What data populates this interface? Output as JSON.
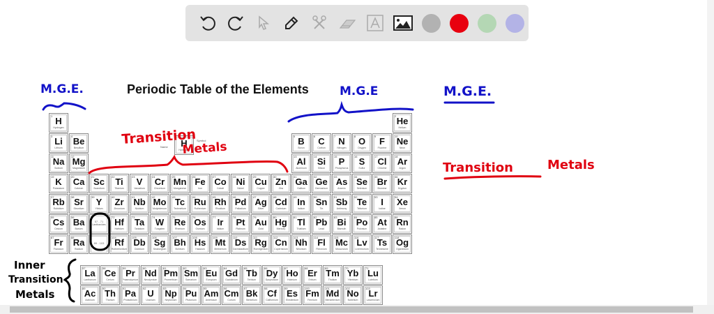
{
  "toolbar": {
    "tools": [
      "undo-icon",
      "redo-icon",
      "select-icon",
      "pen-icon",
      "tools-icon",
      "eraser-icon",
      "text-icon",
      "image-icon"
    ],
    "colors": [
      "#b2b2b2",
      "#e8000f",
      "#b4d7b4",
      "#b3b3e6"
    ]
  },
  "title": "Periodic Table of the Elements",
  "key": {
    "symbol": "H",
    "name_label": "Name",
    "symbol_label": "Symbol",
    "name": "Hydrogen"
  },
  "placeholders": {
    "lanthanides": "57 - 71",
    "lanthanides_name": "Lanthanides",
    "actinides": "89 - 103"
  },
  "elements": [
    [
      1,
      "H",
      "Hydrogen"
    ],
    [
      2,
      "He",
      "Helium"
    ],
    [
      3,
      "Li",
      "Lithium"
    ],
    [
      4,
      "Be",
      "Beryllium"
    ],
    [
      5,
      "B",
      "Boron"
    ],
    [
      6,
      "C",
      "Carbon"
    ],
    [
      7,
      "N",
      "Nitrogen"
    ],
    [
      8,
      "O",
      "Oxygen"
    ],
    [
      9,
      "F",
      "Fluorine"
    ],
    [
      10,
      "Ne",
      "Neon"
    ],
    [
      11,
      "Na",
      "Sodium"
    ],
    [
      12,
      "Mg",
      "Magnesium"
    ],
    [
      13,
      "Al",
      "Aluminum"
    ],
    [
      14,
      "Si",
      "Silicon"
    ],
    [
      15,
      "P",
      "Phosphorus"
    ],
    [
      16,
      "S",
      "Sulfur"
    ],
    [
      17,
      "Cl",
      "Chlorine"
    ],
    [
      18,
      "Ar",
      "Argon"
    ],
    [
      19,
      "K",
      "Potassium"
    ],
    [
      20,
      "Ca",
      "Calcium"
    ],
    [
      21,
      "Sc",
      "Scandium"
    ],
    [
      22,
      "Ti",
      "Titanium"
    ],
    [
      23,
      "V",
      "Vanadium"
    ],
    [
      24,
      "Cr",
      "Chromium"
    ],
    [
      25,
      "Mn",
      "Manganese"
    ],
    [
      26,
      "Fe",
      "Iron"
    ],
    [
      27,
      "Co",
      "Cobalt"
    ],
    [
      28,
      "Ni",
      "Nickel"
    ],
    [
      29,
      "Cu",
      "Copper"
    ],
    [
      30,
      "Zn",
      "Zinc"
    ],
    [
      31,
      "Ga",
      "Gallium"
    ],
    [
      32,
      "Ge",
      "Germanium"
    ],
    [
      33,
      "As",
      "Arsenic"
    ],
    [
      34,
      "Se",
      "Selenium"
    ],
    [
      35,
      "Br",
      "Bromine"
    ],
    [
      36,
      "Kr",
      "Krypton"
    ],
    [
      37,
      "Rb",
      "Rubidium"
    ],
    [
      38,
      "Sr",
      "Strontium"
    ],
    [
      39,
      "Y",
      "Yttrium"
    ],
    [
      40,
      "Zr",
      "Zirconium"
    ],
    [
      41,
      "Nb",
      "Niobium"
    ],
    [
      42,
      "Mo",
      "Molybdenum"
    ],
    [
      43,
      "Tc",
      "Technetium"
    ],
    [
      44,
      "Ru",
      "Ruthenium"
    ],
    [
      45,
      "Rh",
      "Rhodium"
    ],
    [
      46,
      "Pd",
      "Palladium"
    ],
    [
      47,
      "Ag",
      "Silver"
    ],
    [
      48,
      "Cd",
      "Cadmium"
    ],
    [
      49,
      "In",
      "Indium"
    ],
    [
      50,
      "Sn",
      "Tin"
    ],
    [
      51,
      "Sb",
      "Antimony"
    ],
    [
      52,
      "Te",
      "Tellurium"
    ],
    [
      53,
      "I",
      "Iodine"
    ],
    [
      54,
      "Xe",
      "Xenon"
    ],
    [
      55,
      "Cs",
      "Cesium"
    ],
    [
      56,
      "Ba",
      "Barium"
    ],
    [
      57,
      "La",
      "Lanthanum"
    ],
    [
      58,
      "Ce",
      "Cerium"
    ],
    [
      59,
      "Pr",
      "Praseodymium"
    ],
    [
      60,
      "Nd",
      "Neodymium"
    ],
    [
      61,
      "Pm",
      "Promethium"
    ],
    [
      62,
      "Sm",
      "Samarium"
    ],
    [
      63,
      "Eu",
      "Europium"
    ],
    [
      64,
      "Gd",
      "Gadolinium"
    ],
    [
      65,
      "Tb",
      "Terbium"
    ],
    [
      66,
      "Dy",
      "Dysprosium"
    ],
    [
      67,
      "Ho",
      "Holmium"
    ],
    [
      68,
      "Er",
      "Erbium"
    ],
    [
      69,
      "Tm",
      "Thulium"
    ],
    [
      70,
      "Yb",
      "Ytterbium"
    ],
    [
      71,
      "Lu",
      "Lutetium"
    ],
    [
      72,
      "Hf",
      "Hafnium"
    ],
    [
      73,
      "Ta",
      "Tantalum"
    ],
    [
      74,
      "W",
      "Tungsten"
    ],
    [
      75,
      "Re",
      "Rhenium"
    ],
    [
      76,
      "Os",
      "Osmium"
    ],
    [
      77,
      "Ir",
      "Iridium"
    ],
    [
      78,
      "Pt",
      "Platinum"
    ],
    [
      79,
      "Au",
      "Gold"
    ],
    [
      80,
      "Hg",
      "Mercury"
    ],
    [
      81,
      "Tl",
      "Thallium"
    ],
    [
      82,
      "Pb",
      "Lead"
    ],
    [
      83,
      "Bi",
      "Bismuth"
    ],
    [
      84,
      "Po",
      "Polonium"
    ],
    [
      85,
      "At",
      "Astatine"
    ],
    [
      86,
      "Rn",
      "Radon"
    ],
    [
      87,
      "Fr",
      "Francium"
    ],
    [
      88,
      "Ra",
      "Radium"
    ],
    [
      89,
      "Ac",
      "Actinium"
    ],
    [
      90,
      "Th",
      "Thorium"
    ],
    [
      91,
      "Pa",
      "Protactinium"
    ],
    [
      92,
      "U",
      "Uranium"
    ],
    [
      93,
      "Np",
      "Neptunium"
    ],
    [
      94,
      "Pu",
      "Plutonium"
    ],
    [
      95,
      "Am",
      "Americium"
    ],
    [
      96,
      "Cm",
      "Curium"
    ],
    [
      97,
      "Bk",
      "Berkelium"
    ],
    [
      98,
      "Cf",
      "Californium"
    ],
    [
      99,
      "Es",
      "Einsteinium"
    ],
    [
      100,
      "Fm",
      "Fermium"
    ],
    [
      101,
      "Md",
      "Mendelevium"
    ],
    [
      102,
      "No",
      "Nobelium"
    ],
    [
      103,
      "Lr",
      "Lawrencium"
    ],
    [
      104,
      "Rf",
      "Rutherfordium"
    ],
    [
      105,
      "Db",
      "Dubnium"
    ],
    [
      106,
      "Sg",
      "Seaborgium"
    ],
    [
      107,
      "Bh",
      "Bohrium"
    ],
    [
      108,
      "Hs",
      "Hassium"
    ],
    [
      109,
      "Mt",
      "Meitnerium"
    ],
    [
      110,
      "Ds",
      "Darmstadtium"
    ],
    [
      111,
      "Rg",
      "Roentgenium"
    ],
    [
      112,
      "Cn",
      "Copernicium"
    ],
    [
      113,
      "Nh",
      "Nihonium"
    ],
    [
      114,
      "Fl",
      "Flerovium"
    ],
    [
      115,
      "Mc",
      "Moscovium"
    ],
    [
      116,
      "Lv",
      "Livermorium"
    ],
    [
      117,
      "Ts",
      "Tennessine"
    ],
    [
      118,
      "Og",
      "Oganesson"
    ]
  ],
  "annotations": {
    "mge_left": "M.G.E.",
    "mge_title": "M.G.E",
    "mge_right": "M.G.E.",
    "transition_top_1": "Transition",
    "transition_top_2": "Metals",
    "transition_right_1": "Transition",
    "transition_right_2": "Metals",
    "inner_1": "Inner",
    "inner_2": "Transition",
    "inner_3": "Metals",
    "colors": {
      "blue": "#1212c8",
      "red": "#e00010",
      "black": "#000000"
    }
  }
}
